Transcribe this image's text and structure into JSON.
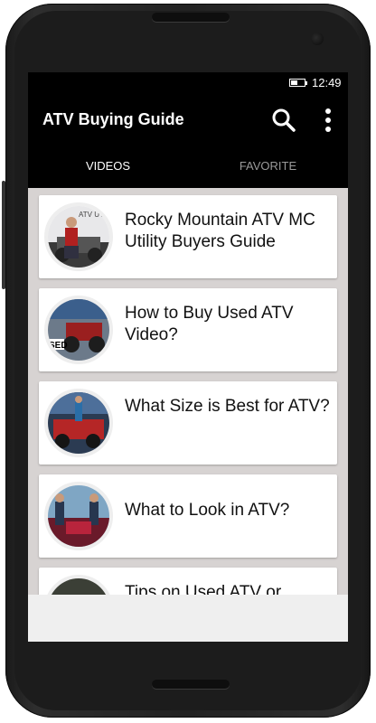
{
  "status_bar": {
    "time": "12:49",
    "battery_level": 0.5
  },
  "app_bar": {
    "title": "ATV Buying Guide",
    "search_icon": "search-icon",
    "menu_icon": "more-vert-icon"
  },
  "tabs": [
    {
      "label": "VIDEOS",
      "selected": true
    },
    {
      "label": "FAVORITE",
      "selected": false
    }
  ],
  "videos": [
    {
      "title": "Rocky Mountain ATV MC Utility Buyers Guide",
      "thumb_text": "ATV UTI"
    },
    {
      "title": "How to Buy Used ATV Video?",
      "thumb_text": "SED"
    },
    {
      "title": "What Size is Best for ATV?"
    },
    {
      "title": "What to Look in ATV?"
    },
    {
      "title": "Tips on Used ATV or"
    }
  ],
  "colors": {
    "toolbar": "#000000",
    "list_background": "#d7d3d2",
    "card": "#ffffff",
    "inactive_tab": "#9a9a9a"
  }
}
